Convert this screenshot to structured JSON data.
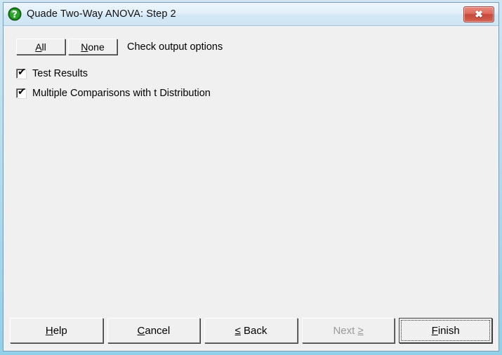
{
  "window": {
    "title": "Quade Two-Way ANOVA: Step 2",
    "icon": "question-mark-icon",
    "close_label": "✖",
    "accent_titlebar": "#d8ecf8",
    "accent_close": "#c64a3b",
    "background": "#f0f0f0"
  },
  "toolbar": {
    "all_label": "All",
    "all_accel": "A",
    "none_label": "None",
    "none_accel": "N",
    "instruction": "Check output options"
  },
  "options": [
    {
      "label": "Test Results",
      "checked": true,
      "tick": "✔"
    },
    {
      "label": "Multiple Comparisons with t Distribution",
      "checked": true,
      "tick": "✔"
    }
  ],
  "footer": {
    "buttons": [
      {
        "name": "help-button",
        "label": "Help",
        "accel_before": "",
        "accel": "H",
        "accel_after": "elp",
        "disabled": false,
        "default": false
      },
      {
        "name": "cancel-button",
        "label": "Cancel",
        "accel_before": "",
        "accel": "C",
        "accel_after": "ancel",
        "disabled": false,
        "default": false
      },
      {
        "name": "back-button",
        "label": "< Back",
        "accel_before": "",
        "accel": "≤",
        "accel_after": " Back",
        "disabled": false,
        "default": false
      },
      {
        "name": "next-button",
        "label": "Next ≥",
        "accel_before": "Next ",
        "accel": "≥",
        "accel_after": "",
        "disabled": true,
        "default": false
      },
      {
        "name": "finish-button",
        "label": "Finish",
        "accel_before": "",
        "accel": "F",
        "accel_after": "inish",
        "disabled": false,
        "default": true
      }
    ]
  }
}
